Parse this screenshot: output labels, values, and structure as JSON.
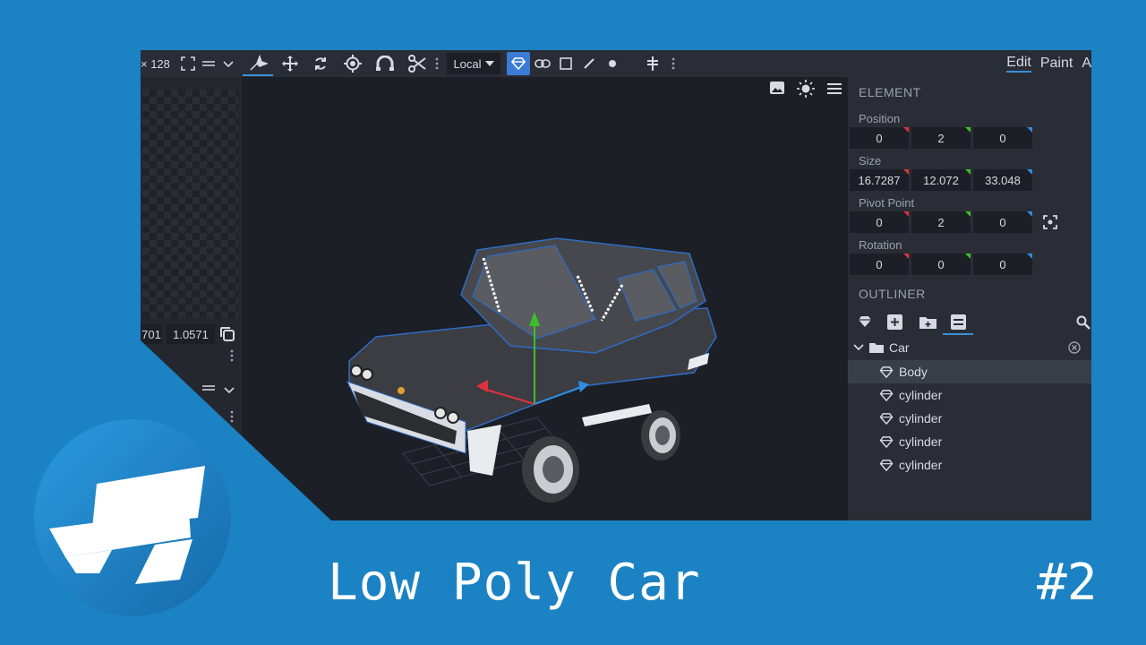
{
  "toolbar": {
    "size_text": "× 128",
    "space_label": "Local",
    "tabs": [
      "Edit",
      "Paint",
      "A"
    ]
  },
  "left_panel": {
    "field_a": "701",
    "field_b": "1.0571"
  },
  "element": {
    "title": "ELEMENT",
    "position": {
      "label": "Position",
      "x": "0",
      "y": "2",
      "z": "0"
    },
    "size": {
      "label": "Size",
      "x": "16.7287",
      "y": "12.072",
      "z": "33.048"
    },
    "pivot": {
      "label": "Pivot Point",
      "x": "0",
      "y": "2",
      "z": "0"
    },
    "rotation": {
      "label": "Rotation",
      "x": "0",
      "y": "0",
      "z": "0"
    }
  },
  "outliner": {
    "title": "OUTLINER",
    "group": "Car",
    "items": [
      {
        "label": "Body",
        "selected": true
      },
      {
        "label": "cylinder",
        "selected": false
      },
      {
        "label": "cylinder",
        "selected": false
      },
      {
        "label": "cylinder",
        "selected": false
      },
      {
        "label": "cylinder",
        "selected": false
      }
    ]
  },
  "video": {
    "title": "Low Poly Car",
    "episode": "#2"
  },
  "colors": {
    "background": "#1b82c3",
    "accent": "#3a8fd9",
    "axis_x": "#e0323c",
    "axis_y": "#3cc02a",
    "axis_z": "#2d8de0"
  }
}
